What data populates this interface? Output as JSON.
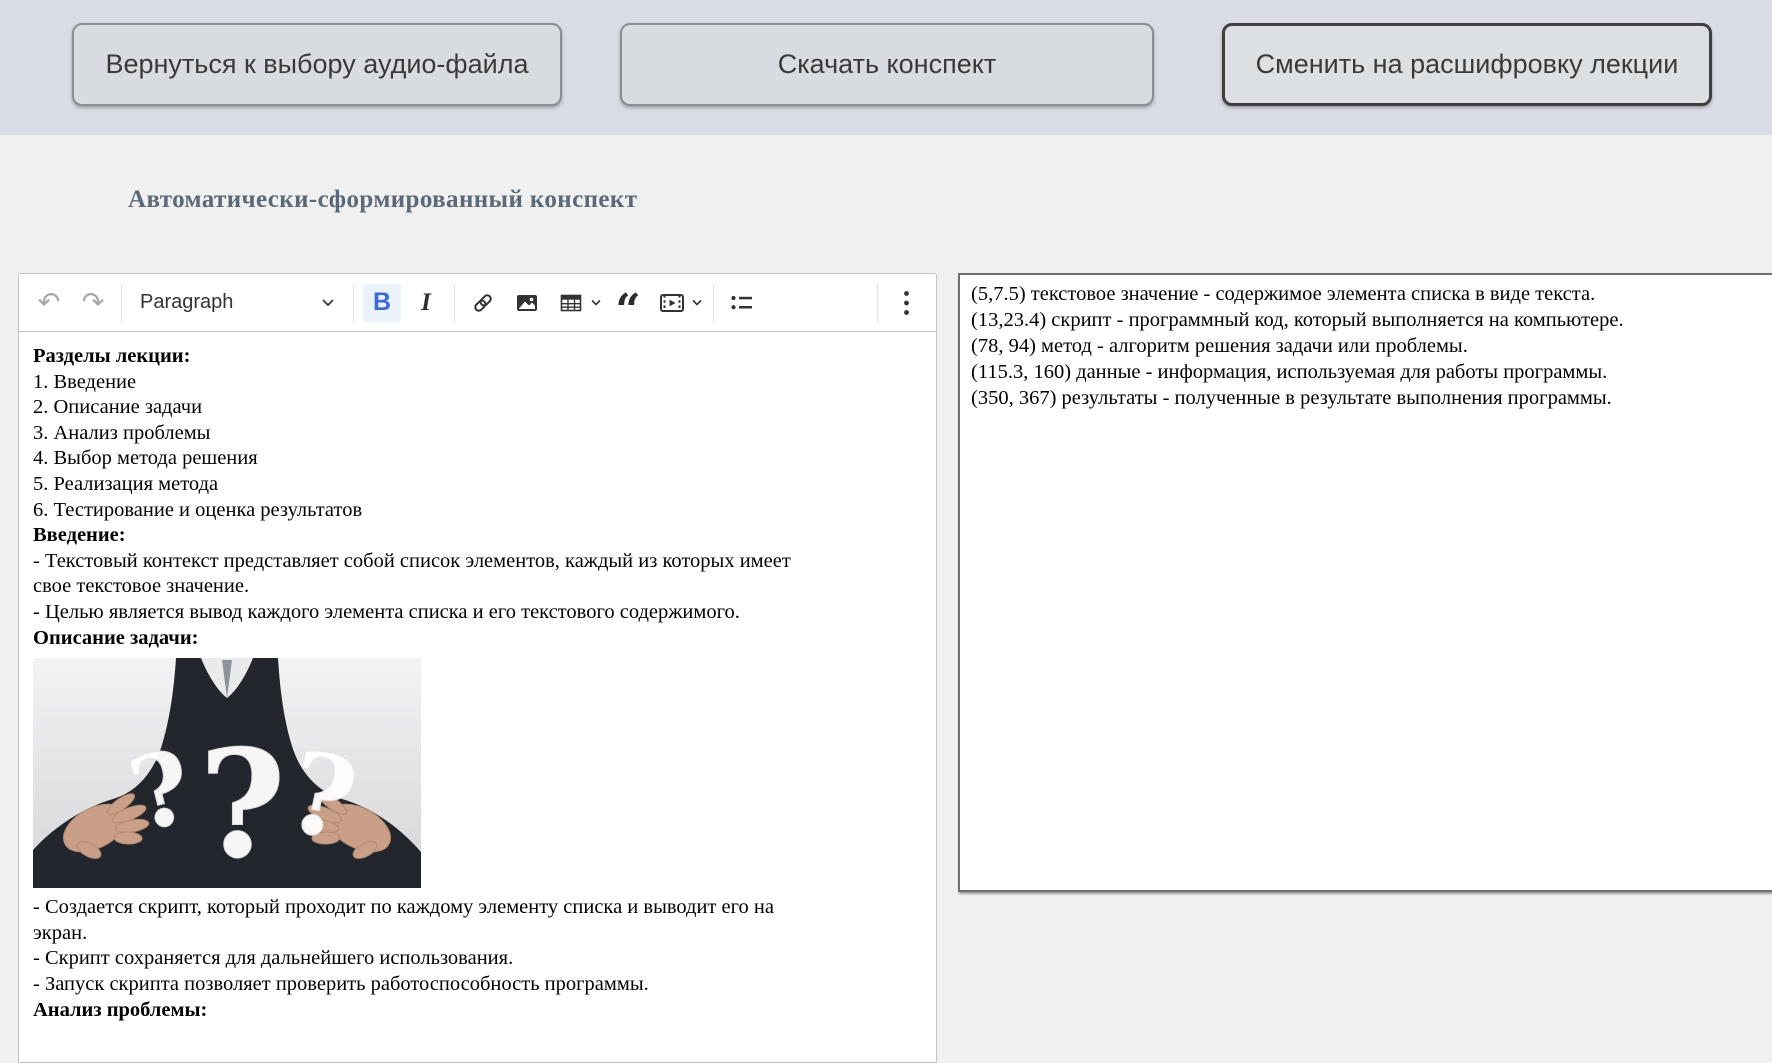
{
  "topbar": {
    "back_button": "Вернуться к выбору аудио-файла",
    "download_button": "Скачать конспект",
    "switch_button": "Сменить на расшифровку лекции"
  },
  "heading": "Автоматически-сформированный конспект",
  "editor": {
    "toolbar": {
      "paragraph_label": "Paragraph",
      "icons": [
        "undo-icon",
        "redo-icon",
        "chevron-down-icon",
        "bold-icon",
        "italic-icon",
        "link-icon",
        "image-icon",
        "table-icon",
        "block-quote-icon",
        "media-embed-icon",
        "bulleted-list-icon",
        "overflow-menu-icon"
      ],
      "bold_active": true
    },
    "blocks": [
      {
        "type": "bold",
        "text": "Разделы лекции:"
      },
      {
        "type": "p",
        "text": "1. Введение"
      },
      {
        "type": "p",
        "text": "2. Описание задачи"
      },
      {
        "type": "p",
        "text": "3. Анализ проблемы"
      },
      {
        "type": "p",
        "text": "4. Выбор метода решения"
      },
      {
        "type": "p",
        "text": "5. Реализация метода"
      },
      {
        "type": "p",
        "text": "6. Тестирование и оценка результатов"
      },
      {
        "type": "bold",
        "text": "Введение:"
      },
      {
        "type": "p",
        "text": "- Текстовый контекст представляет собой список элементов, каждый из которых имеет свое текстовое значение."
      },
      {
        "type": "p",
        "text": "- Целью является вывод каждого элемента списка и его текстового содержимого."
      },
      {
        "type": "bold",
        "text": "Описание задачи:"
      },
      {
        "type": "image",
        "name": "question-marks-photo"
      },
      {
        "type": "p",
        "text": "- Создается скрипт, который проходит по каждому элементу списка и выводит его на экран."
      },
      {
        "type": "p",
        "text": "- Скрипт сохраняется для дальнейшего использования."
      },
      {
        "type": "p",
        "text": "- Запуск скрипта позволяет проверить работоспособность программы."
      },
      {
        "type": "bold",
        "text": "Анализ проблемы:"
      }
    ]
  },
  "transcript": {
    "lines": [
      "(5,7.5) текстовое значение - содержимое элемента списка в виде текста.",
      "(13,23.4) скрипт - программный код, который выполняется на компьютере.",
      "(78, 94) метод - алгоритм решения задачи или проблемы.",
      "(115.3, 160) данные - информация, используемая для работы программы.",
      "(350, 367) результаты - полученные в результате выполнения программы."
    ]
  },
  "colors": {
    "topbar_bg": "#d9dce4",
    "page_bg": "#f0f0f1",
    "heading_text": "#5c6a77",
    "bold_active_icon": "#3a6ad4",
    "bold_active_bg": "#e9f1fb"
  }
}
